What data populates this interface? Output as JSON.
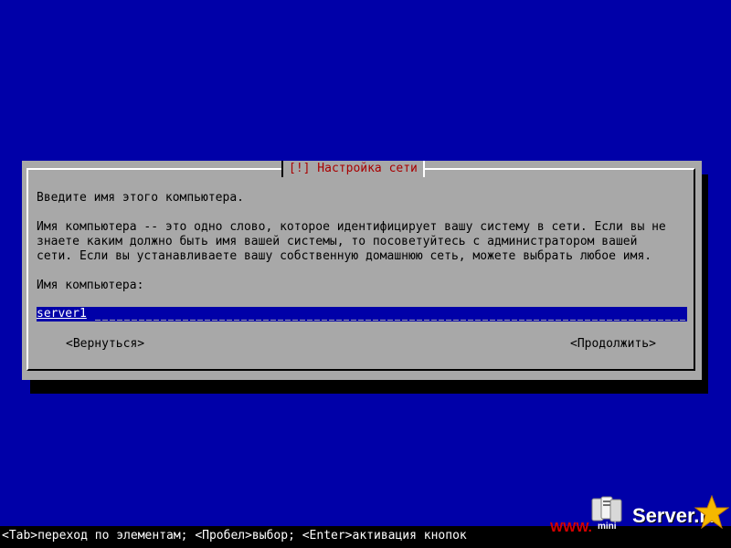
{
  "dialog": {
    "title": "[!] Настройка сети",
    "prompt": "Введите имя этого компьютера.",
    "description": "Имя компьютера -- это одно слово, которое идентифицирует вашу систему в сети. Если вы не\nзнаете каким должно быть имя вашей системы, то посоветуйтесь с администратором вашей\nсети. Если вы устанавливаете вашу собственную домашнюю сеть, можете выбрать любое имя.",
    "field_label": "Имя компьютера:",
    "hostname_value": "server1",
    "back_button": "<Вернуться>",
    "continue_button": "<Продолжить>"
  },
  "statusbar": {
    "help": "<Tab>переход по элементам; <Пробел>выбор; <Enter>активация кнопок"
  },
  "watermark": {
    "www": "WWW.",
    "mini": "mini",
    "server": "Server.ru"
  },
  "colors": {
    "background": "#0000a8",
    "dialog": "#a8a8a8",
    "title": "#a80000",
    "statusbar": "#000000"
  }
}
